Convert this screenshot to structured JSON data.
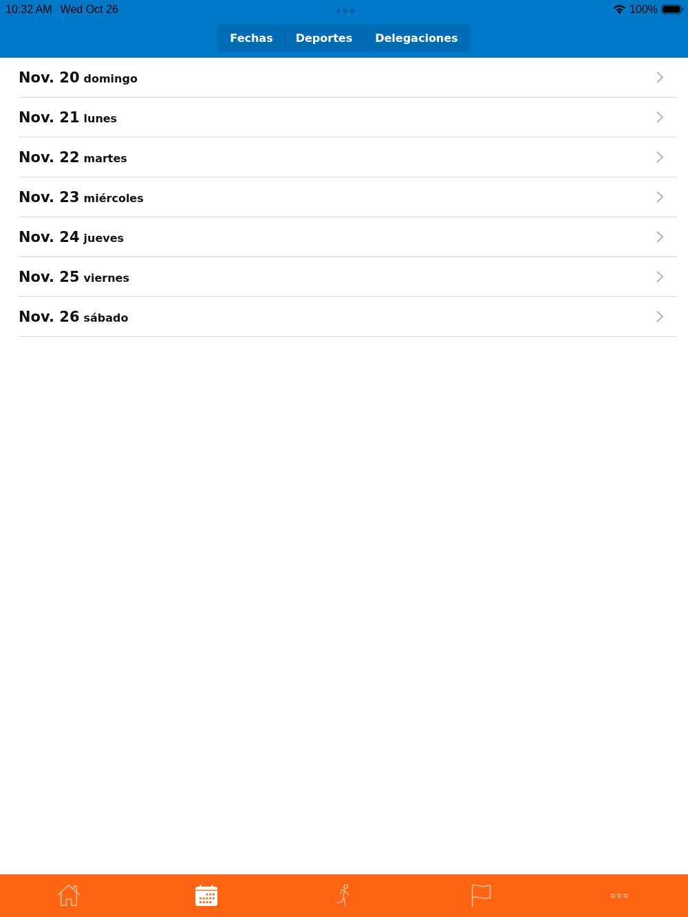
{
  "status_bar": {
    "time": "10:32 AM",
    "date": "Wed Oct 26",
    "battery": "100%"
  },
  "segments": [
    {
      "label": "Fechas"
    },
    {
      "label": "Deportes"
    },
    {
      "label": "Delegaciones"
    }
  ],
  "days": [
    {
      "date": "Nov. 20",
      "weekday": "domingo"
    },
    {
      "date": "Nov. 21",
      "weekday": "lunes"
    },
    {
      "date": "Nov. 22",
      "weekday": "martes"
    },
    {
      "date": "Nov. 23",
      "weekday": "miércoles"
    },
    {
      "date": "Nov. 24",
      "weekday": "jueves"
    },
    {
      "date": "Nov. 25",
      "weekday": "viernes"
    },
    {
      "date": "Nov. 26",
      "weekday": "sábado"
    }
  ],
  "tab_bar": [
    {
      "kind": "home",
      "selected": false
    },
    {
      "kind": "calendar",
      "selected": true
    },
    {
      "kind": "sport",
      "selected": false
    },
    {
      "kind": "flag",
      "selected": false
    },
    {
      "kind": "more",
      "selected": false
    }
  ]
}
